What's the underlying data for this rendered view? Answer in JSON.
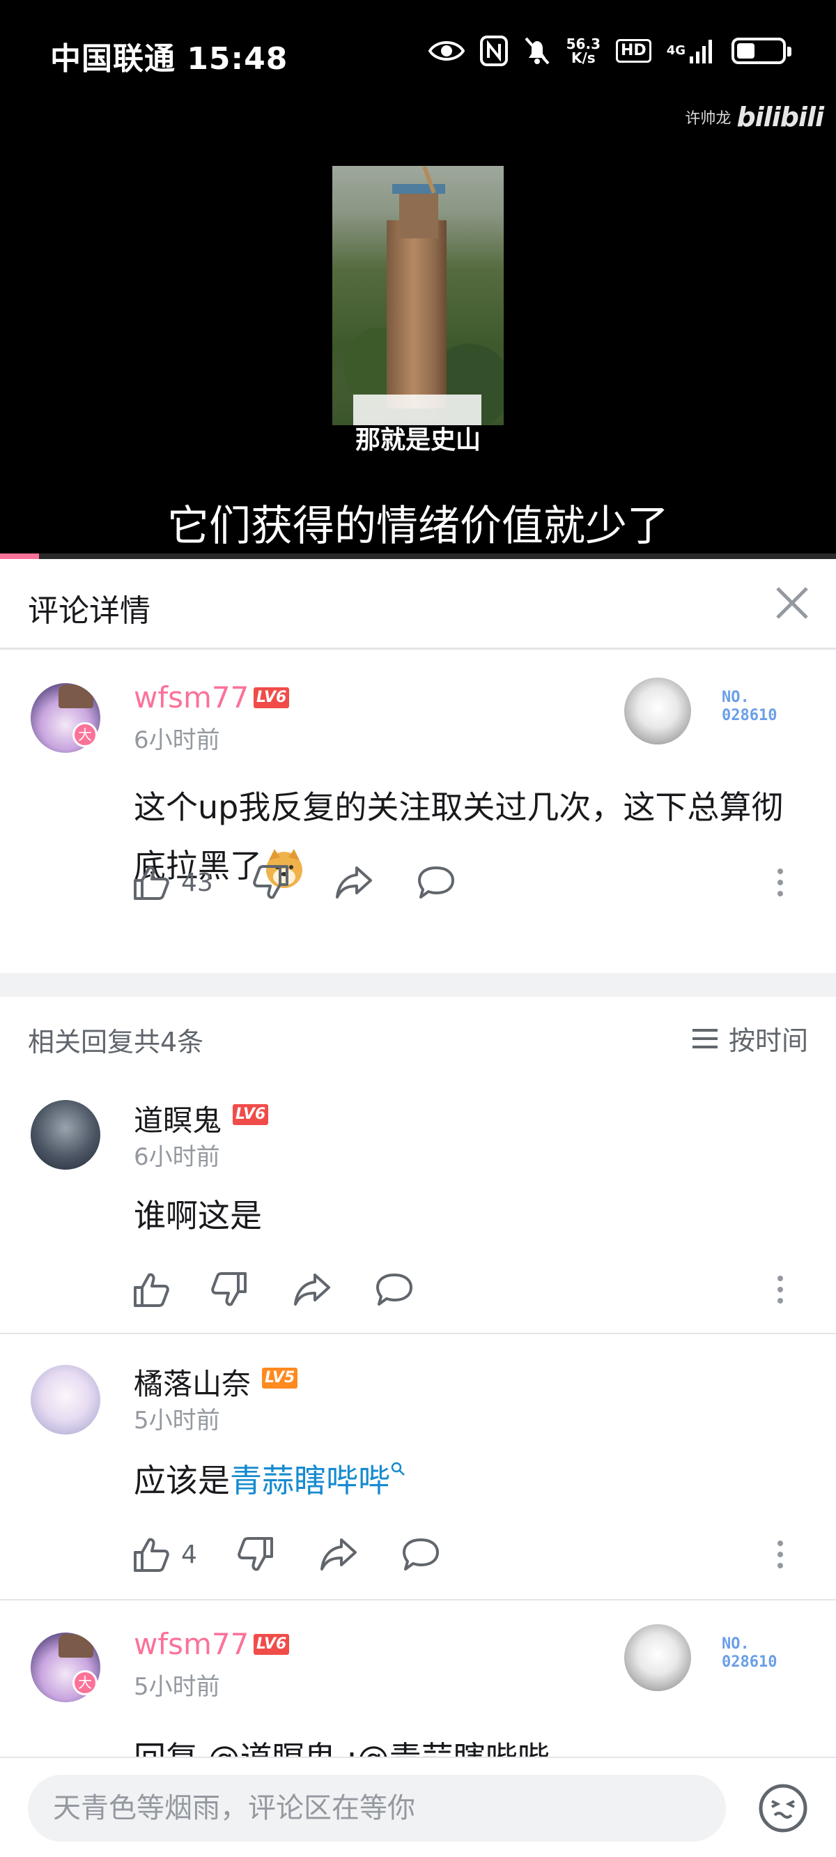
{
  "status_bar": {
    "carrier_time": "中国联通 15:48",
    "net_speed_top": "56.3",
    "net_speed_bottom": "K/s",
    "hd_label": "HD",
    "network_label": "4G",
    "battery_percent": 40
  },
  "video": {
    "watermark_user": "许帅龙",
    "watermark_logo": "bilibili",
    "inner_caption": "那就是史山",
    "subtitle": "它们获得的情绪价值就少了",
    "progress_fraction": 0.047,
    "progress_color": "#fb7299"
  },
  "panel": {
    "title": "评论详情",
    "close_icon": "close-icon"
  },
  "main_comment": {
    "username": "wfsm77",
    "level": "LV6",
    "time": "6小时前",
    "text": "这个up我反复的关注取关过几次，这下总算彻底拉黑了",
    "emoji": "doge-emoji",
    "fan_badge_label": "NO.",
    "fan_badge_number": "028610",
    "likes": "43",
    "badge_char": "大"
  },
  "replies_header": {
    "count_label": "相关回复共4条",
    "sort_label": "按时间"
  },
  "replies": [
    {
      "username": "道瞑鬼",
      "level": "LV6",
      "time": "6小时前",
      "text": "谁啊这是",
      "likes": ""
    },
    {
      "username": "橘落山奈",
      "level": "LV5",
      "time": "5小时前",
      "text_prefix": "应该是",
      "link_text": "青蒜瞎哔哔",
      "likes": "4"
    },
    {
      "username": "wfsm77",
      "level": "LV6",
      "time": "5小时前",
      "text": "回复 @道瞑鬼 :@青蒜瞎哔哔",
      "fan_badge_label": "NO.",
      "fan_badge_number": "028610",
      "badge_char": "大"
    }
  ],
  "bottom_bar": {
    "placeholder": "天青色等烟雨，评论区在等你"
  },
  "colors": {
    "accent_pink": "#fb7299",
    "link_blue": "#178bcf",
    "lv6": "#f04c49",
    "lv5": "#ff8a1f"
  }
}
